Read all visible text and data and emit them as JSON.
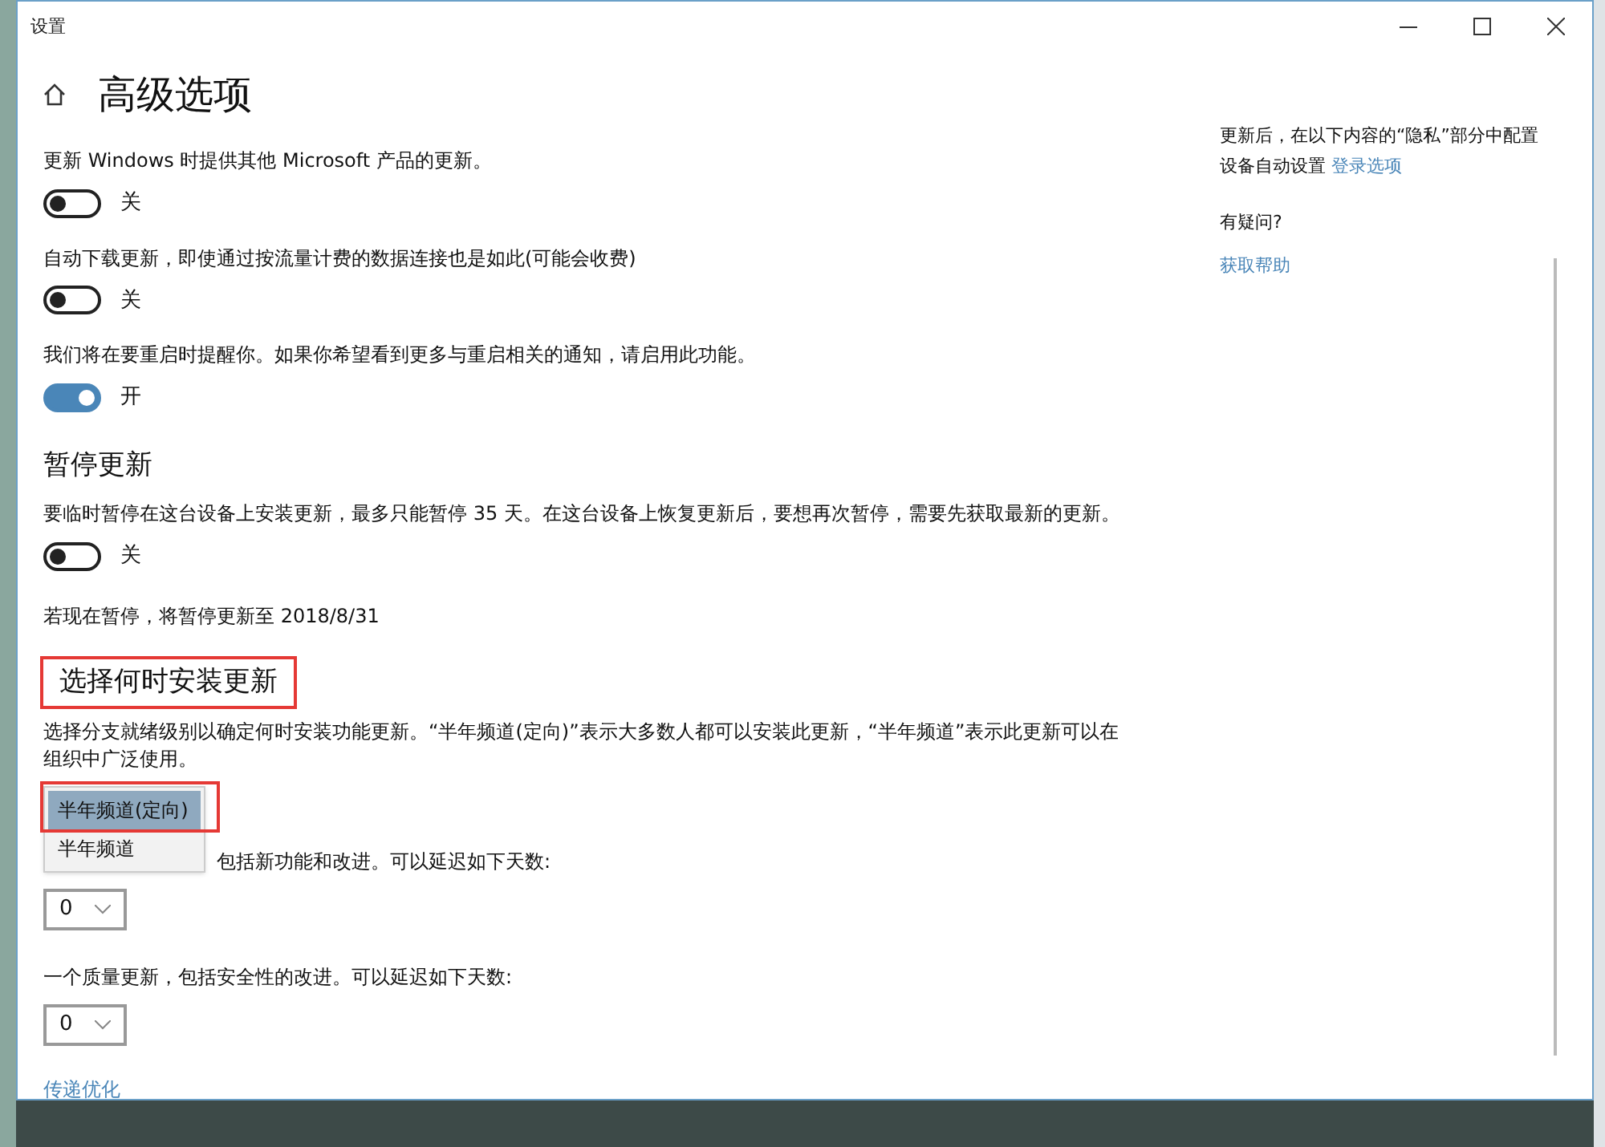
{
  "window": {
    "title": "设置"
  },
  "page_title": "高级选项",
  "toggles": [
    {
      "label": "更新 Windows 时提供其他 Microsoft 产品的更新。",
      "on": false,
      "state_text": "关"
    },
    {
      "label": "自动下载更新，即使通过按流量计费的数据连接也是如此(可能会收费)",
      "on": false,
      "state_text": "关"
    },
    {
      "label": "我们将在要重启时提醒你。如果你希望看到更多与重启相关的通知，请启用此功能。",
      "on": true,
      "state_text": "开"
    }
  ],
  "pause": {
    "heading": "暂停更新",
    "description": "要临时暂停在这台设备上安装更新，最多只能暂停 35 天。在这台设备上恢复更新后，要想再次暂停，需要先获取最新的更新。",
    "on": false,
    "state_text": "关",
    "note": "若现在暂停，将暂停更新至 2018/8/31"
  },
  "install": {
    "heading": "选择何时安装更新",
    "description": "选择分支就绪级别以确定何时安装功能更新。“半年频道(定向)”表示大多数人都可以安装此更新，“半年频道”表示此更新可以在组织中广泛使用。",
    "branch_menu": [
      {
        "label": "半年频道(定向)",
        "selected": true
      },
      {
        "label": "半年频道",
        "selected": false
      }
    ],
    "feature_label": "包括新功能和改进。可以延迟如下天数:",
    "feature_days": "0",
    "quality_label": "一个质量更新，包括安全性的改进。可以延迟如下天数:",
    "quality_days": "0"
  },
  "delivery_link": "传递优化",
  "side": {
    "privacy_text": "更新后，在以下内容的“隐私”部分中配置设备自动设置",
    "privacy_link": "登录选项",
    "question": "有疑问?",
    "help_link": "获取帮助"
  }
}
